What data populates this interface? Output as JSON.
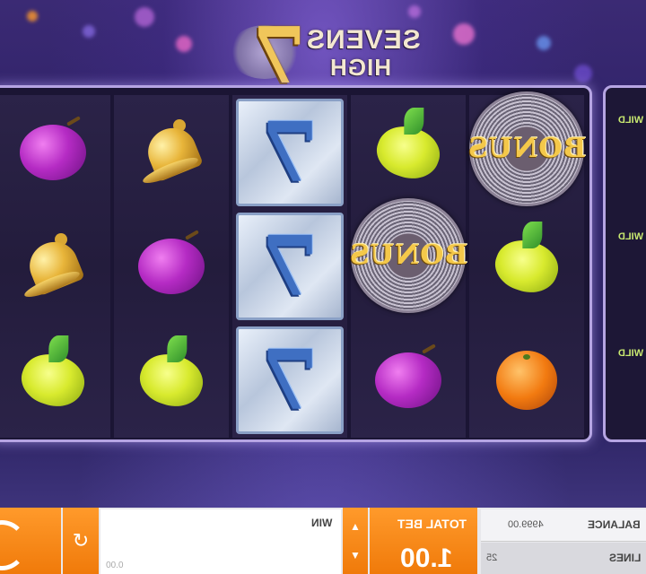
{
  "game": {
    "logo_line1": "SEVENS",
    "logo_line2": "HIGH",
    "logo_numeral": "7"
  },
  "reels": [
    [
      "plum",
      "bell",
      "lemon"
    ],
    [
      "bell",
      "plum",
      "lemon"
    ],
    [
      "seven",
      "seven",
      "seven"
    ],
    [
      "lemon",
      "bonus",
      "plum"
    ],
    [
      "bonus",
      "lemon",
      "orange"
    ]
  ],
  "symbols": {
    "seven_text": "7",
    "bonus_text": "BONUS"
  },
  "side_reel": {
    "wild_label": "WILD"
  },
  "controls": {
    "win_label": "WIN",
    "win_small": "0.00",
    "bet_label": "TOTAL BET",
    "bet_value": "1.00",
    "balance_label": "BALANCE",
    "balance_value": "4999.00",
    "lines_label": "LINES",
    "lines_value": "25"
  },
  "colors": {
    "accent": "#f07a0a",
    "reel_border": "#b6a5e3",
    "background": "#2d2166"
  }
}
